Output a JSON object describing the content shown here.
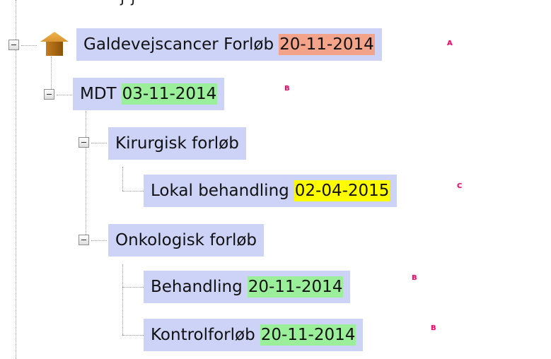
{
  "header_clipped_text": "j     j",
  "tree": {
    "root": {
      "label": "Galdevejscancer Forløb",
      "date": "20-11-2014",
      "badge": "A"
    },
    "mdt": {
      "label": "MDT",
      "date": "03-11-2014",
      "badge": "B"
    },
    "kirurgisk": {
      "label": "Kirurgisk forløb"
    },
    "lokal": {
      "label": "Lokal behandling",
      "date": "02-04-2015",
      "badge": "C"
    },
    "onkologisk": {
      "label": "Onkologisk forløb"
    },
    "behandling": {
      "label": "Behandling",
      "date": "20-11-2014",
      "badge": "B"
    },
    "kontrol": {
      "label": "Kontrolforløb",
      "date": "20-11-2014",
      "badge": "B"
    }
  },
  "colors": {
    "selection_bg": "#ccd3f7",
    "date_red": "#f2a38a",
    "date_green": "#9bef9a",
    "date_yellow": "#fdfd00",
    "badge": "#e0106a"
  },
  "icons": {
    "root_node": "house-icon",
    "expander": "collapse-minus-icon"
  }
}
